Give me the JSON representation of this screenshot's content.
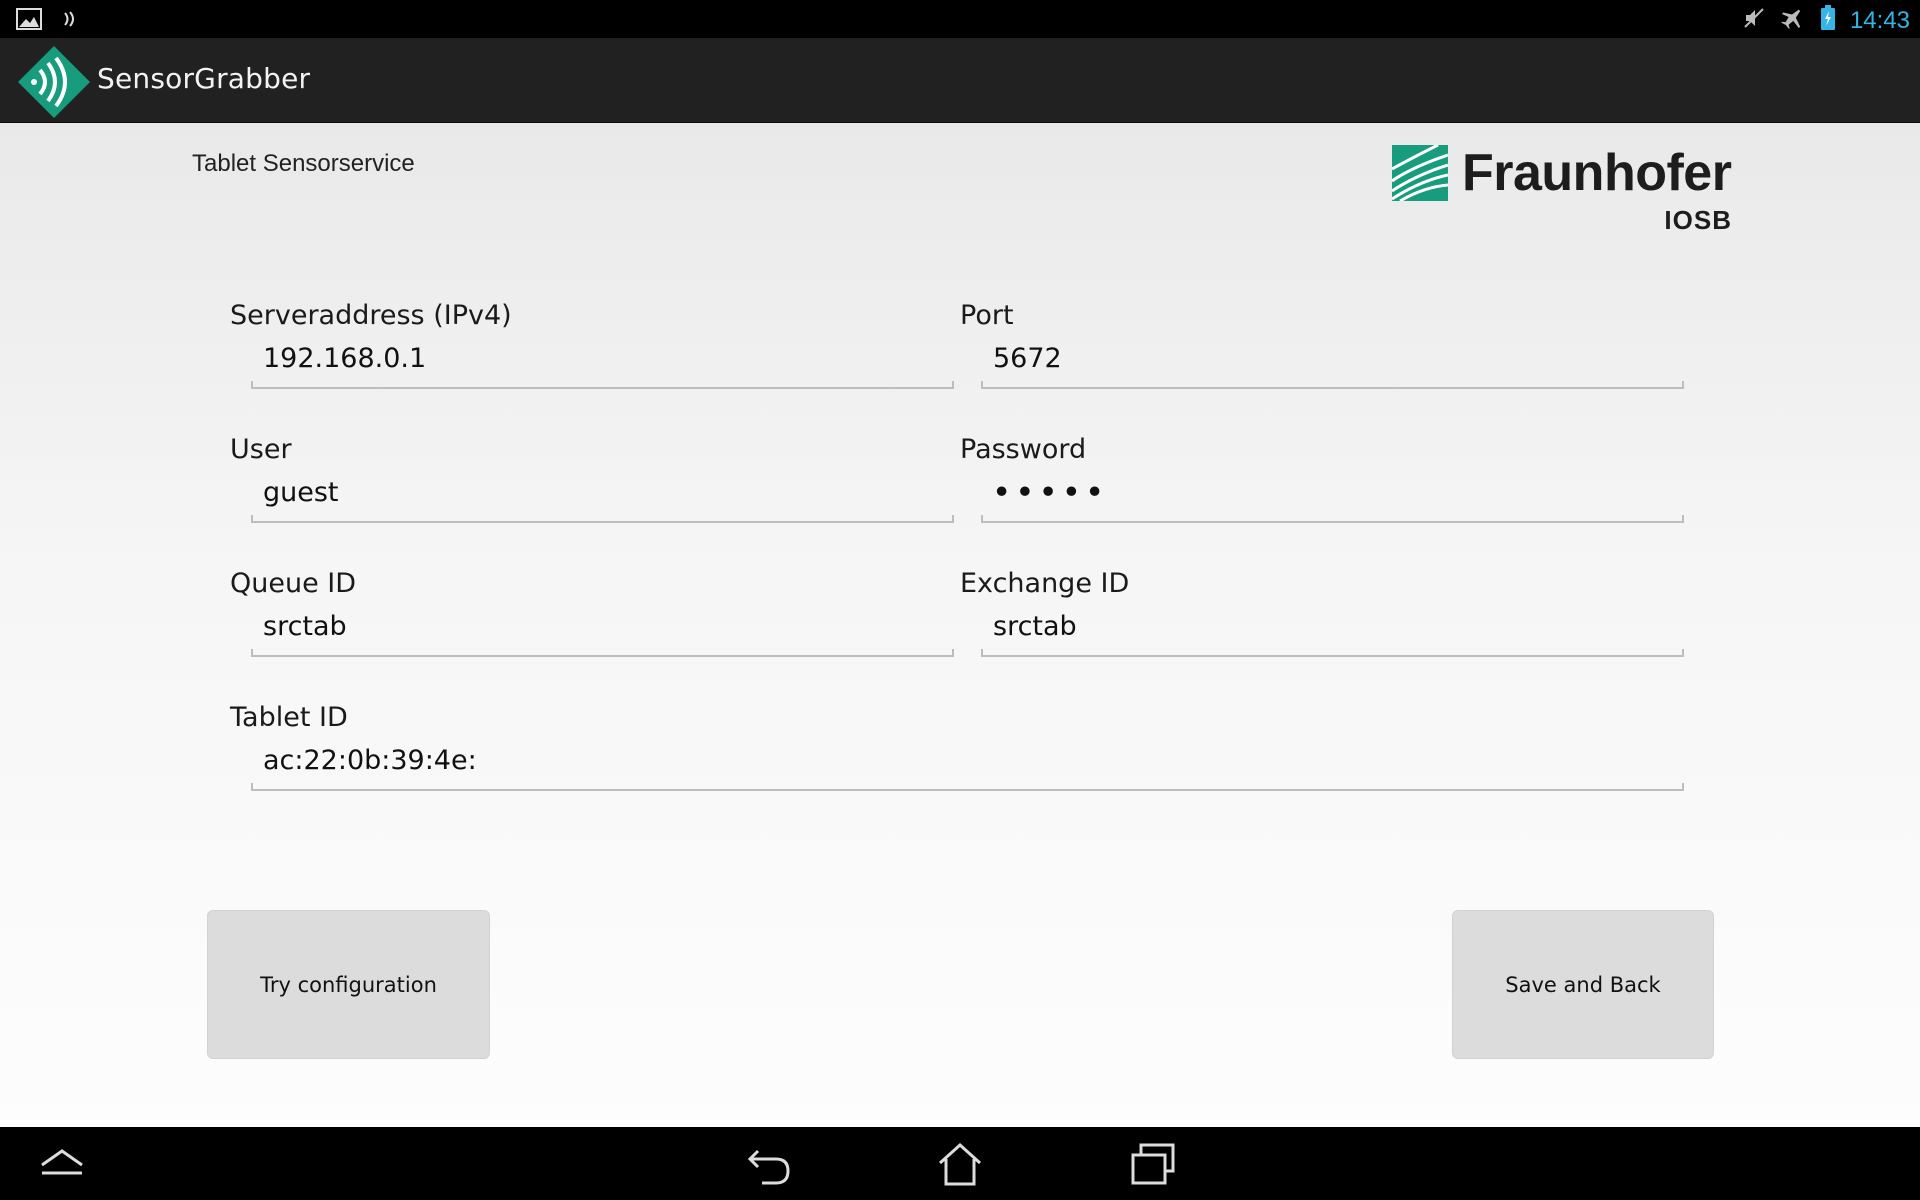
{
  "status_bar": {
    "time": "14:43",
    "left_icons": [
      "gallery-icon",
      "sensor-notification-icon"
    ],
    "right_icons": [
      "mute-icon",
      "airplane-mode-icon",
      "battery-icon"
    ]
  },
  "action_bar": {
    "app_title": "SensorGrabber",
    "app_icon": "sensorgrabber-logo-icon"
  },
  "header": {
    "subtitle": "Tablet Sensorservice",
    "brand_name": "Fraunhofer",
    "brand_sub": "IOSB"
  },
  "form": {
    "server": {
      "label": "Serveraddress (IPv4)",
      "value": "192.168.0.1"
    },
    "port": {
      "label": "Port",
      "value": "5672"
    },
    "user": {
      "label": "User",
      "value": "guest"
    },
    "password": {
      "label": "Password",
      "value": "•••••"
    },
    "queue": {
      "label": "Queue ID",
      "value": "srctab"
    },
    "exchange": {
      "label": "Exchange ID",
      "value": "srctab"
    },
    "tablet": {
      "label": "Tablet ID",
      "value": "ac:22:0b:39:4e:"
    }
  },
  "buttons": {
    "try": "Try configuration",
    "save": "Save and Back"
  },
  "nav_bar": {
    "icons": [
      "menu-up-icon",
      "back-icon",
      "home-icon",
      "recent-apps-icon"
    ]
  },
  "colors": {
    "accent": "#33b5e5",
    "brand_green": "#179c7d",
    "action_bar": "#212121",
    "button": "#dcdcdc"
  }
}
